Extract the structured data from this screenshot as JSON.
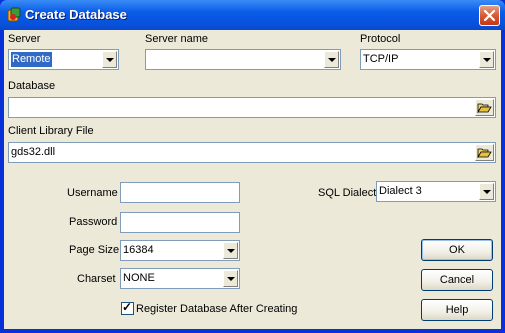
{
  "window": {
    "title": "Create Database"
  },
  "server": {
    "label": "Server",
    "value": "Remote"
  },
  "server_name": {
    "label": "Server name",
    "value": ""
  },
  "protocol": {
    "label": "Protocol",
    "value": "TCP/IP"
  },
  "database": {
    "label": "Database",
    "value": ""
  },
  "client_library": {
    "label": "Client Library File",
    "value": "gds32.dll"
  },
  "username": {
    "label": "Username",
    "value": ""
  },
  "password": {
    "label": "Password",
    "value": ""
  },
  "page_size": {
    "label": "Page Size",
    "value": "16384"
  },
  "charset": {
    "label": "Charset",
    "value": "NONE"
  },
  "sql_dialect": {
    "label": "SQL Dialect",
    "value": "Dialect 3"
  },
  "register": {
    "label": "Register Database After Creating",
    "checked": true
  },
  "buttons": {
    "ok": "OK",
    "cancel": "Cancel",
    "help": "Help"
  },
  "icons": {
    "app": "database-app-icon",
    "close": "close-icon",
    "browse": "folder-open-icon",
    "dropdown": "chevron-down-icon"
  }
}
